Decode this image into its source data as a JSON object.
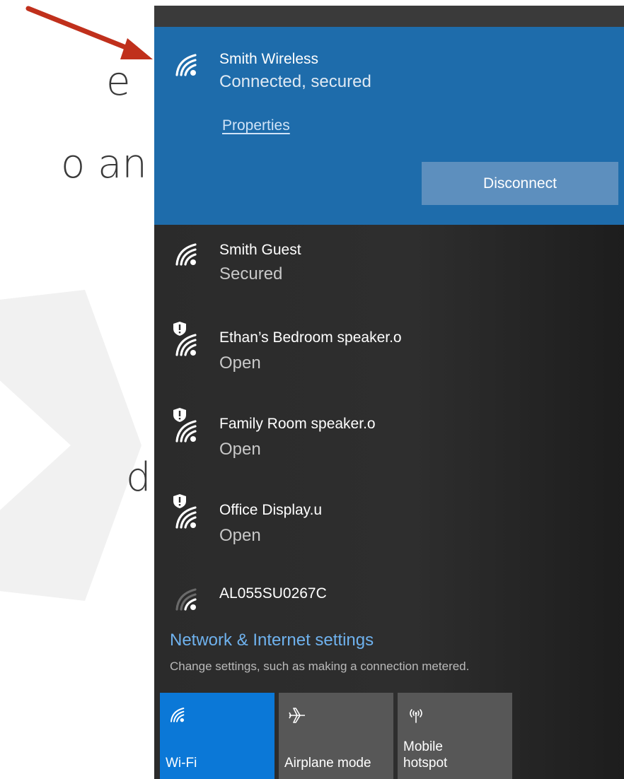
{
  "slide": {
    "fragments": [
      "e",
      "o an",
      "d"
    ]
  },
  "wifi_flyout": {
    "connected_network": {
      "name": "Smith Wireless",
      "status": "Connected, secured",
      "properties_label": "Properties",
      "disconnect_label": "Disconnect",
      "icon": "wifi-signal-icon"
    },
    "networks": [
      {
        "name": "Smith Guest",
        "status": "Secured",
        "icon": "wifi-signal-icon",
        "shield": false
      },
      {
        "name": "Ethan’s Bedroom speaker.o",
        "status": "Open",
        "icon": "wifi-open-warning-icon",
        "shield": true
      },
      {
        "name": "Family Room speaker.o",
        "status": "Open",
        "icon": "wifi-open-warning-icon",
        "shield": true
      },
      {
        "name": "Office Display.u",
        "status": "Open",
        "icon": "wifi-open-warning-icon",
        "shield": true
      },
      {
        "name": "AL055SU0267C",
        "status": "",
        "icon": "wifi-weak-signal-icon",
        "shield": false
      }
    ],
    "settings": {
      "link_label": "Network & Internet settings",
      "description": "Change settings, such as making a connection metered."
    },
    "quick_actions": [
      {
        "label": "Wi-Fi",
        "icon": "wifi-icon",
        "active": true
      },
      {
        "label": "Airplane mode",
        "icon": "airplane-icon",
        "active": false
      },
      {
        "label": "Mobile\nhotspot",
        "label_line1": "Mobile",
        "label_line2": "hotspot",
        "icon": "hotspot-icon",
        "active": false
      }
    ]
  },
  "colors": {
    "accent_blue": "#1e6cab",
    "active_tile": "#0b78d7",
    "link_blue": "#6fb2ee",
    "annotation_arrow": "#c0301c"
  }
}
